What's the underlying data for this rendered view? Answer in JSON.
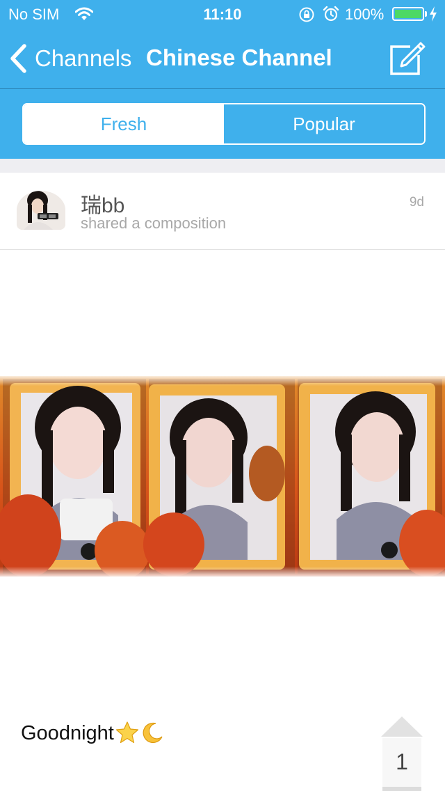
{
  "status_bar": {
    "carrier": "No SIM",
    "time": "11:10",
    "battery_percent": "100%",
    "battery_level": 1.0,
    "icons": [
      "wifi-icon",
      "rotation-lock-icon",
      "alarm-icon",
      "battery-icon",
      "charging-icon"
    ]
  },
  "nav": {
    "back_label": "Channels",
    "title": "Chinese Channel",
    "compose_icon": "compose-icon"
  },
  "segments": {
    "fresh": "Fresh",
    "popular": "Popular",
    "selected": "Fresh"
  },
  "post": {
    "username": "瑞bb",
    "action": "shared a composition",
    "time_ago": "9d",
    "caption": "Goodnight",
    "caption_emojis": [
      "star-emoji",
      "crescent-moon-emoji"
    ],
    "votes": "1"
  },
  "colors": {
    "accent": "#3fb0ec",
    "battery": "#4cd964",
    "background": "#ffffff"
  }
}
